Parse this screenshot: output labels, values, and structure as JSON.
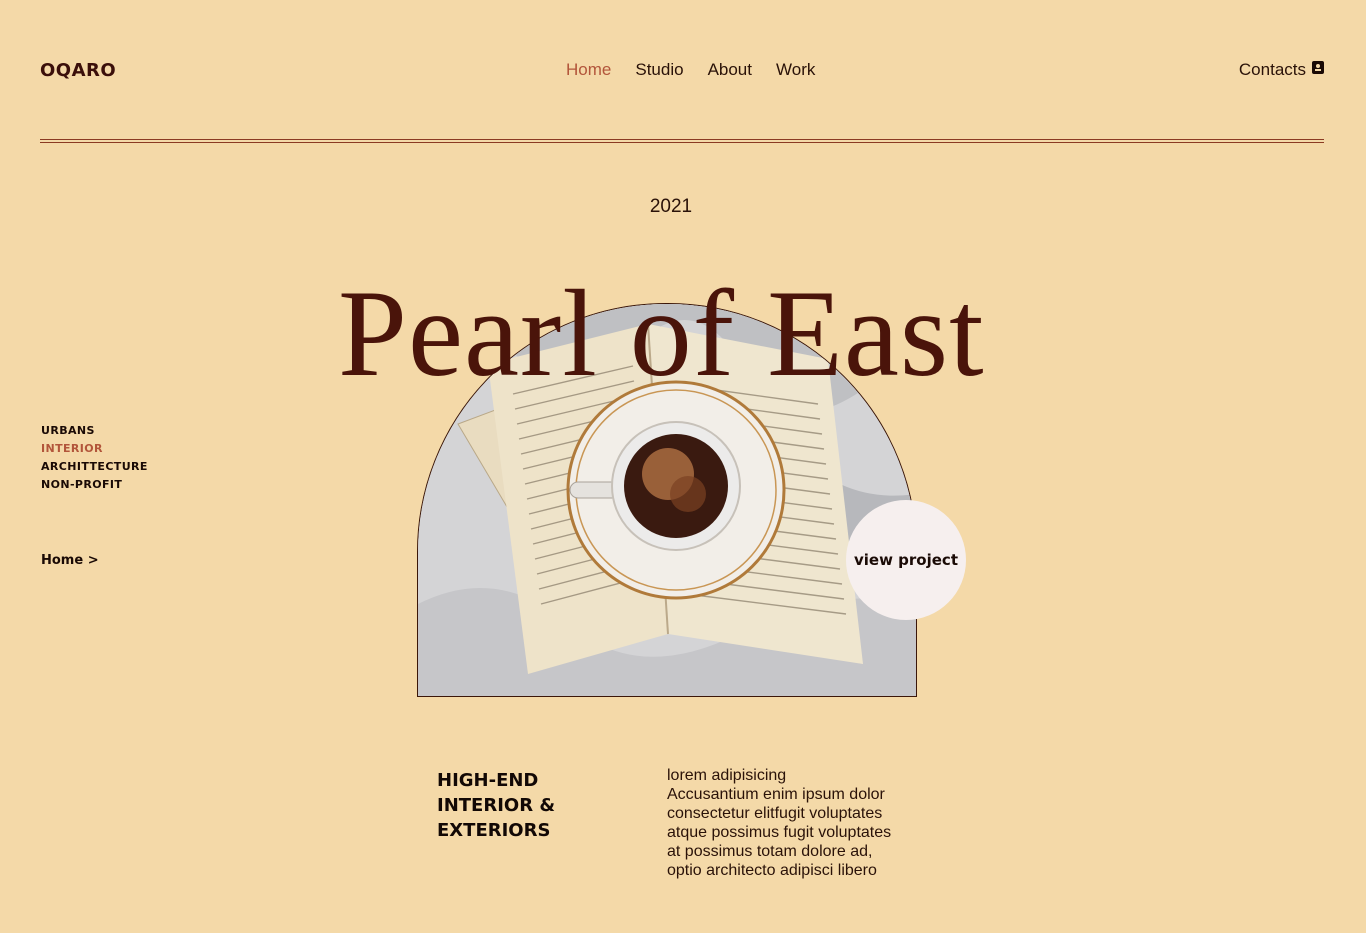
{
  "header": {
    "logo": "OQARO",
    "nav": [
      {
        "label": "Home",
        "active": true
      },
      {
        "label": "Studio",
        "active": false
      },
      {
        "label": "About",
        "active": false
      },
      {
        "label": "Work",
        "active": false
      }
    ],
    "contacts_label": "Contacts",
    "contacts_icon": "contact-card-icon"
  },
  "hero": {
    "year": "2021",
    "title": "Pearl of East",
    "view_button": "view project",
    "image_alt": "coffee cup on open book"
  },
  "left_menu": {
    "items": [
      {
        "label": "URBANS",
        "active": false
      },
      {
        "label": "INTERIOR",
        "active": true
      },
      {
        "label": "ARCHITTECTURE",
        "active": false
      },
      {
        "label": "NON-PROFIT",
        "active": false
      }
    ],
    "breadcrumb": "Home >"
  },
  "content": {
    "headline": "HIGH-END\nINTERIOR &\nEXTERIORS",
    "paragraph": "             lorem adipisicing\nAccusantium enim ipsum dolor\nconsectetur elitfugit voluptates\natque possimus fugit voluptates\nat possimus totam dolore ad,\noptio architecto adipisci libero"
  },
  "colors": {
    "background": "#f4d9a8",
    "accent": "#b2553a",
    "title": "#4a140a"
  }
}
